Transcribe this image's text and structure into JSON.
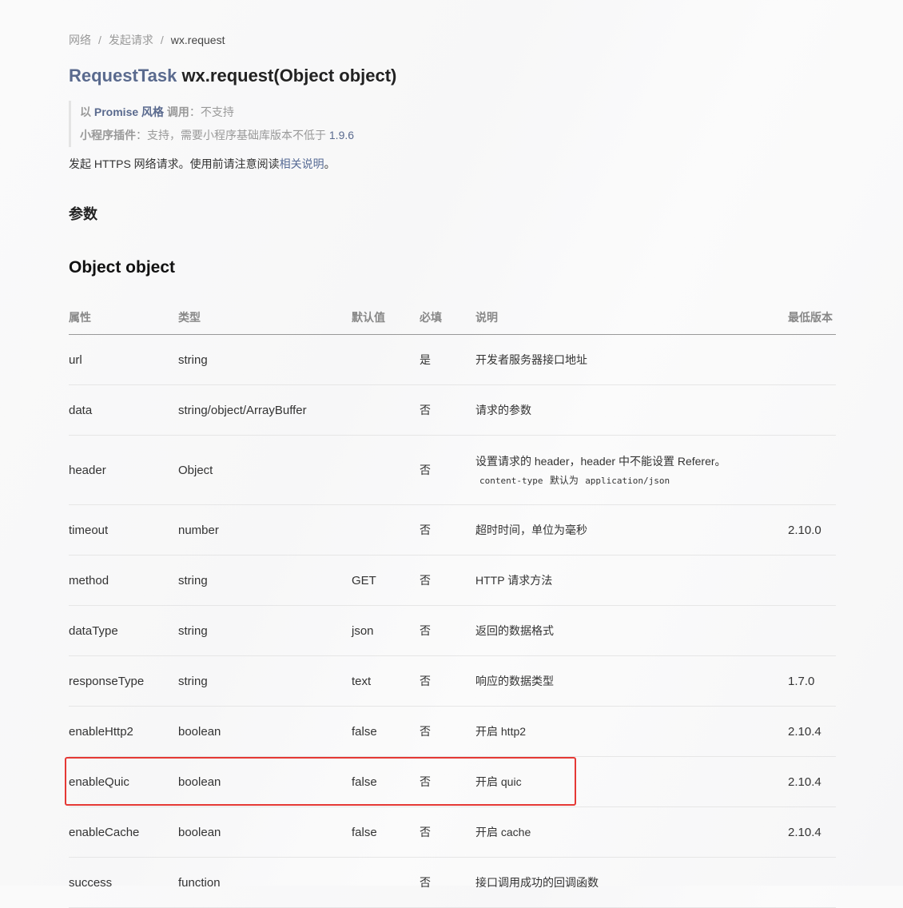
{
  "breadcrumb": {
    "items": [
      "网络",
      "发起请求"
    ],
    "current": "wx.request"
  },
  "title": {
    "return_type": "RequestTask",
    "signature": "wx.request(Object object)"
  },
  "quote": {
    "line1": {
      "prefix": "以",
      "link": "Promise 风格",
      "label": "调用",
      "value": "不支持"
    },
    "line2": {
      "label": "小程序插件",
      "value": "支持，需要小程序基础库版本不低于",
      "version": "1.9.6"
    }
  },
  "description": {
    "text": "发起 HTTPS 网络请求。使用前请注意阅读",
    "link": "相关说明",
    "end": "。"
  },
  "section_title": "参数",
  "subsection_title": "Object object",
  "table": {
    "headers": [
      "属性",
      "类型",
      "默认值",
      "必填",
      "说明",
      "最低版本"
    ],
    "rows": [
      {
        "name": "url",
        "type": "string",
        "default": "",
        "required": "是",
        "desc": "开发者服务器接口地址",
        "version": ""
      },
      {
        "name": "data",
        "type": "string/object/ArrayBuffer",
        "default": "",
        "required": "否",
        "desc": "请求的参数",
        "version": ""
      },
      {
        "name": "header",
        "type": "Object",
        "default": "",
        "required": "否",
        "desc": "设置请求的 header，header 中不能设置 Referer。",
        "code1": "content-type",
        "mid": "默认为",
        "code2": "application/json",
        "version": ""
      },
      {
        "name": "timeout",
        "type": "number",
        "default": "",
        "required": "否",
        "desc": "超时时间，单位为毫秒",
        "version": "2.10.0"
      },
      {
        "name": "method",
        "type": "string",
        "default": "GET",
        "required": "否",
        "desc": "HTTP 请求方法",
        "version": ""
      },
      {
        "name": "dataType",
        "type": "string",
        "default": "json",
        "required": "否",
        "desc": "返回的数据格式",
        "version": ""
      },
      {
        "name": "responseType",
        "type": "string",
        "default": "text",
        "required": "否",
        "desc": "响应的数据类型",
        "version": "1.7.0"
      },
      {
        "name": "enableHttp2",
        "type": "boolean",
        "default": "false",
        "required": "否",
        "desc": "开启 http2",
        "version": "2.10.4"
      },
      {
        "name": "enableQuic",
        "type": "boolean",
        "default": "false",
        "required": "否",
        "desc": "开启 quic",
        "version": "2.10.4"
      },
      {
        "name": "enableCache",
        "type": "boolean",
        "default": "false",
        "required": "否",
        "desc": "开启 cache",
        "version": "2.10.4"
      },
      {
        "name": "success",
        "type": "function",
        "default": "",
        "required": "否",
        "desc": "接口调用成功的回调函数",
        "version": ""
      }
    ]
  },
  "highlight_color": "#e53935",
  "link_color": "#576b95"
}
